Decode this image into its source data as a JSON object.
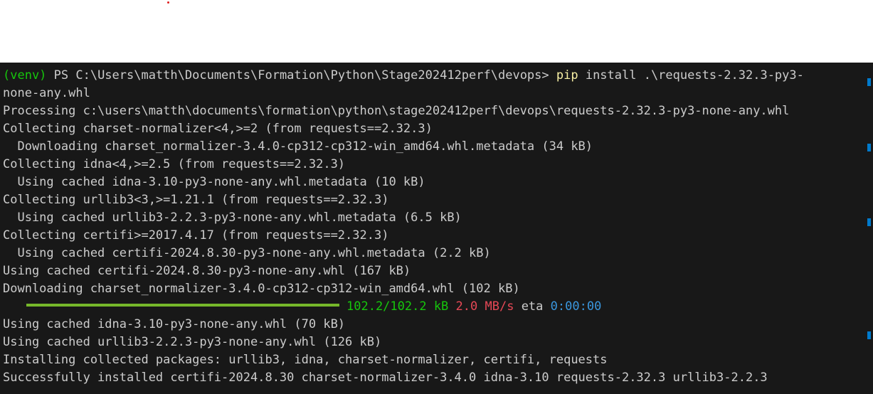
{
  "terminal": {
    "cut_top_line": "                                                                                                                 ",
    "line1": {
      "venv": "(venv)",
      "prompt": " PS C:\\Users\\matth\\Documents\\Formation\\Python\\Stage202412perf\\devops> ",
      "cmd": "pip",
      "args": " install .\\requests-2.32.3-py3-"
    },
    "line2": "none-any.whl",
    "line3": "Processing c:\\users\\matth\\documents\\formation\\python\\stage202412perf\\devops\\requests-2.32.3-py3-none-any.whl",
    "line4": "Collecting charset-normalizer<4,>=2 (from requests==2.32.3)",
    "line5": "  Downloading charset_normalizer-3.4.0-cp312-cp312-win_amd64.whl.metadata (34 kB)",
    "line6": "Collecting idna<4,>=2.5 (from requests==2.32.3)",
    "line7": "  Using cached idna-3.10-py3-none-any.whl.metadata (10 kB)",
    "line8": "Collecting urllib3<3,>=1.21.1 (from requests==2.32.3)",
    "line9": "  Using cached urllib3-2.2.3-py3-none-any.whl.metadata (6.5 kB)",
    "line10": "Collecting certifi>=2017.4.17 (from requests==2.32.3)",
    "line11": "  Using cached certifi-2024.8.30-py3-none-any.whl.metadata (2.2 kB)",
    "line12": "Using cached certifi-2024.8.30-py3-none-any.whl (167 kB)",
    "line13": "Downloading charset_normalizer-3.4.0-cp312-cp312-win_amd64.whl (102 kB)",
    "progress": {
      "fraction": 1.0,
      "size": "102.2/102.2 kB",
      "speed": "2.0 MB/s",
      "eta_label": "eta",
      "eta": "0:00:00"
    },
    "line15": "Using cached idna-3.10-py3-none-any.whl (70 kB)",
    "line16": "Using cached urllib3-2.2.3-py3-none-any.whl (126 kB)",
    "line17": "Installing collected packages: urllib3, idna, charset-normalizer, certifi, requests",
    "line18": "Successfully installed certifi-2024.8.30 charset-normalizer-3.4.0 idna-3.10 requests-2.32.3 urllib3-2.2.3"
  },
  "colors": {
    "background": "#181818",
    "text": "#cccccc",
    "venv_green": "#16c60c",
    "command_yellow": "#f9f1a5",
    "progress_green": "#76b82a",
    "speed_red": "#e74856",
    "eta_cyan": "#3a96dd",
    "scroll_marker": "#007acc"
  }
}
